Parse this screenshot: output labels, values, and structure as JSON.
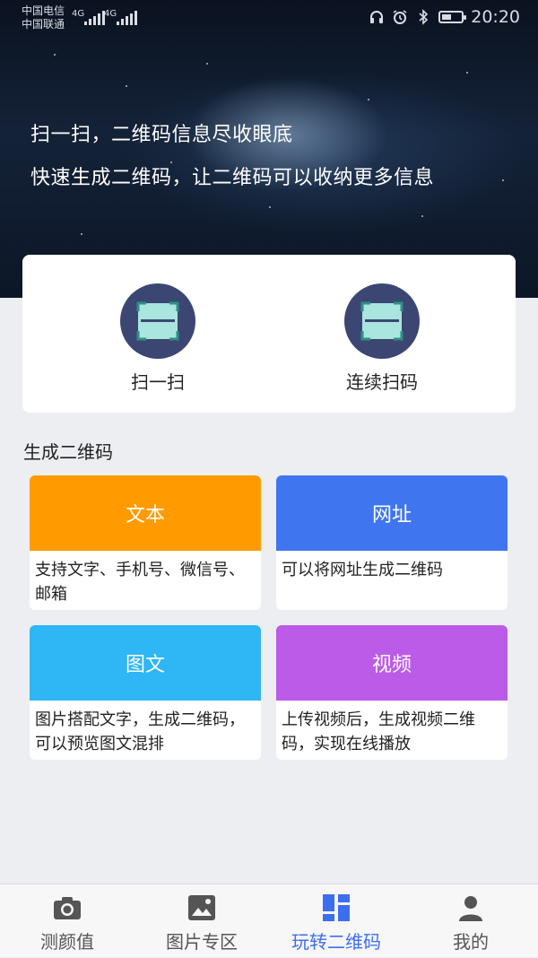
{
  "status_bar": {
    "carrier_1": "中国电信",
    "carrier_2": "中国联通",
    "network_1": "4G",
    "network_2": "4G",
    "time": "20:20",
    "icons": [
      "headphones-icon",
      "alarm-icon",
      "bluetooth-icon",
      "battery-icon"
    ]
  },
  "hero": {
    "line1": "扫一扫，二维码信息尽收眼底",
    "line2": "快速生成二维码，让二维码可以收纳更多信息"
  },
  "scan_actions": [
    {
      "label": "扫一扫",
      "icon": "scan-icon"
    },
    {
      "label": "连续扫码",
      "icon": "scan-icon"
    }
  ],
  "generate": {
    "title": "生成二维码",
    "cards": [
      {
        "title": "文本",
        "desc": "支持文字、手机号、微信号、邮箱",
        "color": "#FF9A00"
      },
      {
        "title": "网址",
        "desc": "可以将网址生成二维码",
        "color": "#3F76F0"
      },
      {
        "title": "图文",
        "desc": "图片搭配文字，生成二维码，可以预览图文混排",
        "color": "#2EB6F5"
      },
      {
        "title": "视频",
        "desc": "上传视频后，生成视频二维码，实现在线播放",
        "color": "#BB5BE8"
      }
    ]
  },
  "bottom_nav": {
    "active_index": 2,
    "active_color": "#3D6EF0",
    "items": [
      {
        "label": "测颜值",
        "icon": "camera-icon"
      },
      {
        "label": "图片专区",
        "icon": "image-icon"
      },
      {
        "label": "玩转二维码",
        "icon": "qr-grid-icon"
      },
      {
        "label": "我的",
        "icon": "user-icon"
      }
    ]
  }
}
